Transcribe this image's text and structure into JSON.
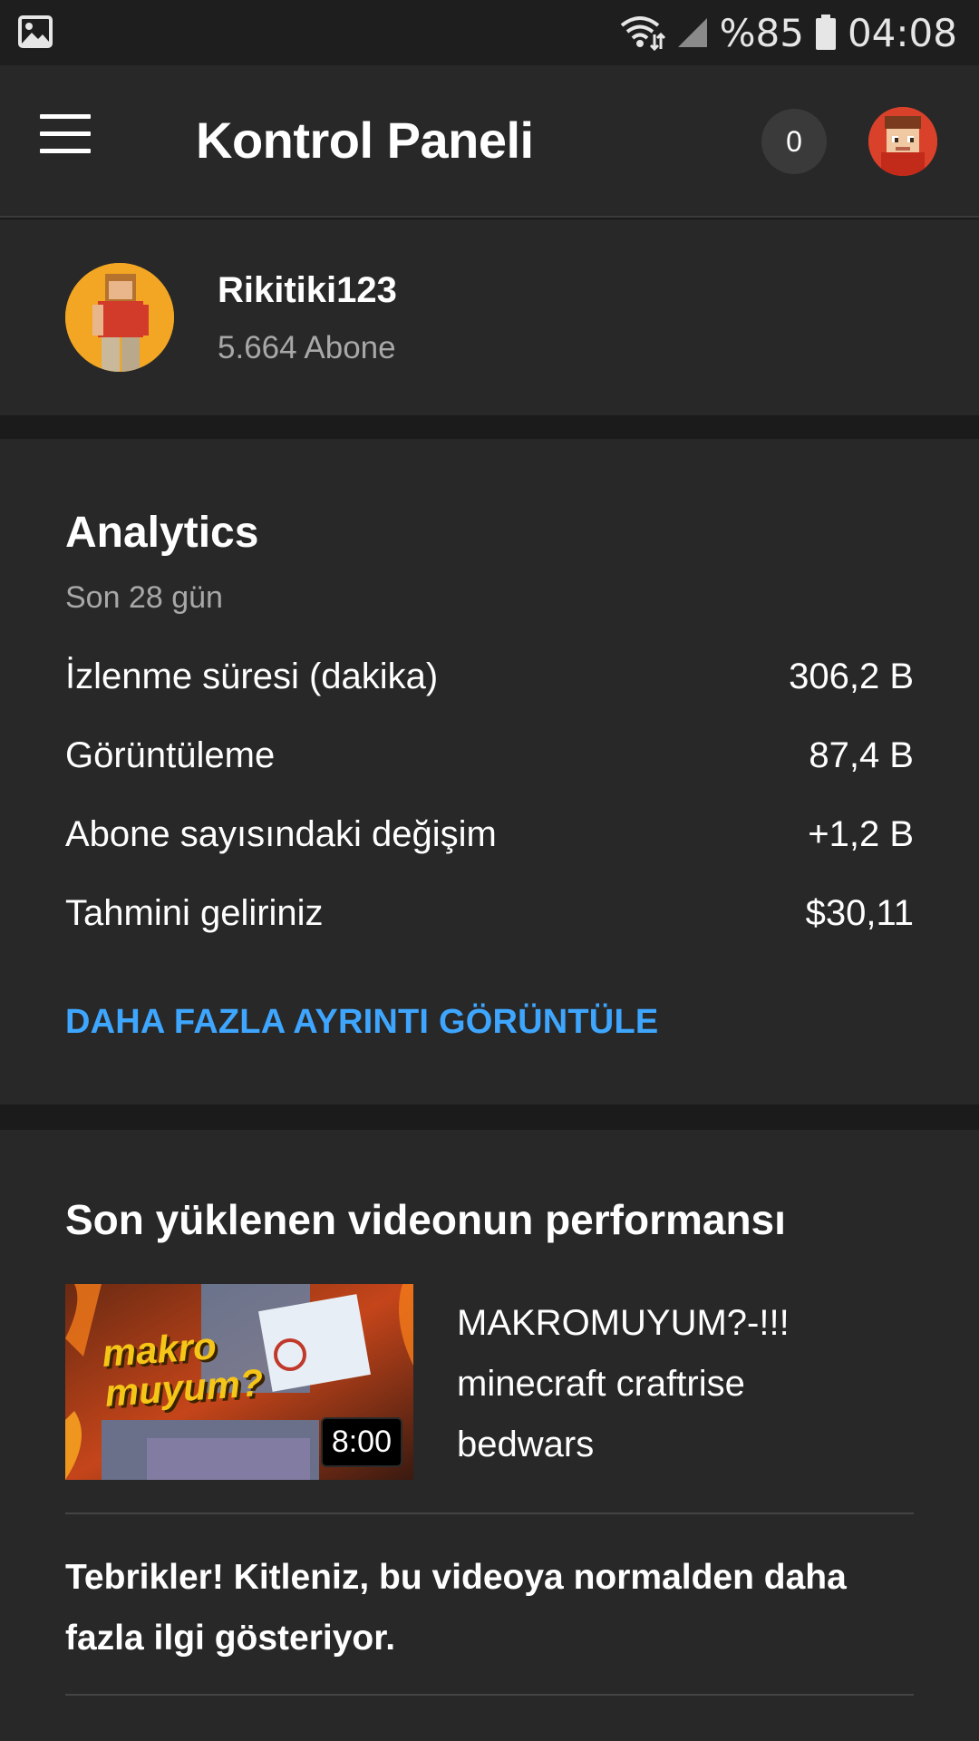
{
  "status_bar": {
    "battery_percent": "%85",
    "time": "04:08",
    "left_icon": "image-icon",
    "icons": [
      "wifi-icon",
      "signal-icon",
      "battery-icon"
    ]
  },
  "app_bar": {
    "title": "Kontrol Paneli",
    "notifications_count": "0",
    "menu_icon": "hamburger-menu-icon"
  },
  "channel": {
    "name": "Rikitiki123",
    "subscribers": "5.664 Abone"
  },
  "analytics": {
    "title": "Analytics",
    "period": "Son 28 gün",
    "metrics": [
      {
        "label": "İzlenme süresi (dakika)",
        "value": "306,2 B"
      },
      {
        "label": "Görüntüleme",
        "value": "87,4 B"
      },
      {
        "label": "Abone sayısındaki değişim",
        "value": "+1,2 B"
      },
      {
        "label": "Tahmini geliriniz",
        "value": "$30,11"
      }
    ],
    "more_link": "DAHA FAZLA AYRINTI GÖRÜNTÜLE"
  },
  "latest_video": {
    "heading": "Son yüklenen videonun performansı",
    "thumbnail_text": "makro muyum?",
    "duration": "8:00",
    "title_lines": [
      "MAKROMUYUM?-!!!",
      "minecraft craftrise",
      "bedwars"
    ],
    "congrats_lines": [
      "Tebrikler! Kitleniz, bu videoya normalden daha",
      "fazla ilgi gösteriyor."
    ]
  },
  "colors": {
    "background": "#1b1b1b",
    "card": "#282828",
    "accent_link": "#3ea6ff",
    "secondary_text": "#a8a8a8"
  }
}
